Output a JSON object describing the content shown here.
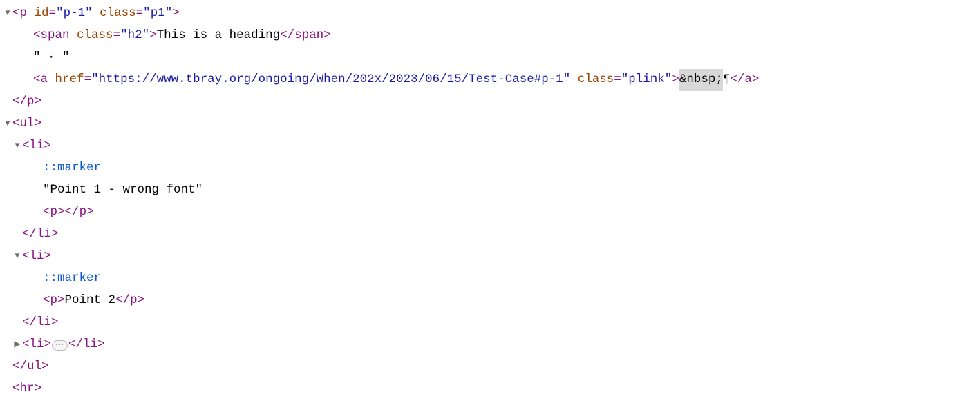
{
  "lines": {
    "l1": {
      "open_tag": "<",
      "tag": "p",
      "attr1_name": "id",
      "attr1_val": "p-1",
      "attr2_name": "class",
      "attr2_val": "p1",
      "close": ">"
    },
    "l2": {
      "open_tag": "<",
      "tag": "span",
      "attr1_name": "class",
      "attr1_val": "h2",
      "close": ">",
      "text": "This is a heading",
      "end_open": "</",
      "end_tag": "span",
      "end_close": ">"
    },
    "l3": {
      "text": "\" · \""
    },
    "l4": {
      "open_tag": "<",
      "tag": "a",
      "attr1_name": "href",
      "attr1_val": "https://www.tbray.org/ongoing/When/202x/2023/06/15/Test-Case#p-1",
      "attr2_name": "class",
      "attr2_val": "plink",
      "close": ">",
      "entity": "&nbsp;",
      "pilcrow": "¶",
      "end_open": "</",
      "end_tag": "a",
      "end_close": ">"
    },
    "l5": {
      "open": "</",
      "tag": "p",
      "close": ">"
    },
    "l6": {
      "open": "<",
      "tag": "ul",
      "close": ">"
    },
    "l7": {
      "open": "<",
      "tag": "li",
      "close": ">"
    },
    "l8": {
      "text": "::marker"
    },
    "l9": {
      "text": "\"Point 1 - wrong font\""
    },
    "l10": {
      "open": "<",
      "tag": "p",
      "close": ">",
      "end_open": "</",
      "end_tag": "p",
      "end_close": ">"
    },
    "l11": {
      "open": "</",
      "tag": "li",
      "close": ">"
    },
    "l12": {
      "open": "<",
      "tag": "li",
      "close": ">"
    },
    "l13": {
      "text": "::marker"
    },
    "l14": {
      "open": "<",
      "tag": "p",
      "close": ">",
      "text": "Point 2",
      "end_open": "</",
      "end_tag": "p",
      "end_close": ">"
    },
    "l15": {
      "open": "</",
      "tag": "li",
      "close": ">"
    },
    "l16": {
      "open": "<",
      "tag": "li",
      "close": ">",
      "ellipsis": "⋯",
      "end_open": "</",
      "end_tag": "li",
      "end_close": ">"
    },
    "l17": {
      "open": "</",
      "tag": "ul",
      "close": ">"
    },
    "l18": {
      "open": "<",
      "tag": "hr",
      "close": ">"
    }
  }
}
